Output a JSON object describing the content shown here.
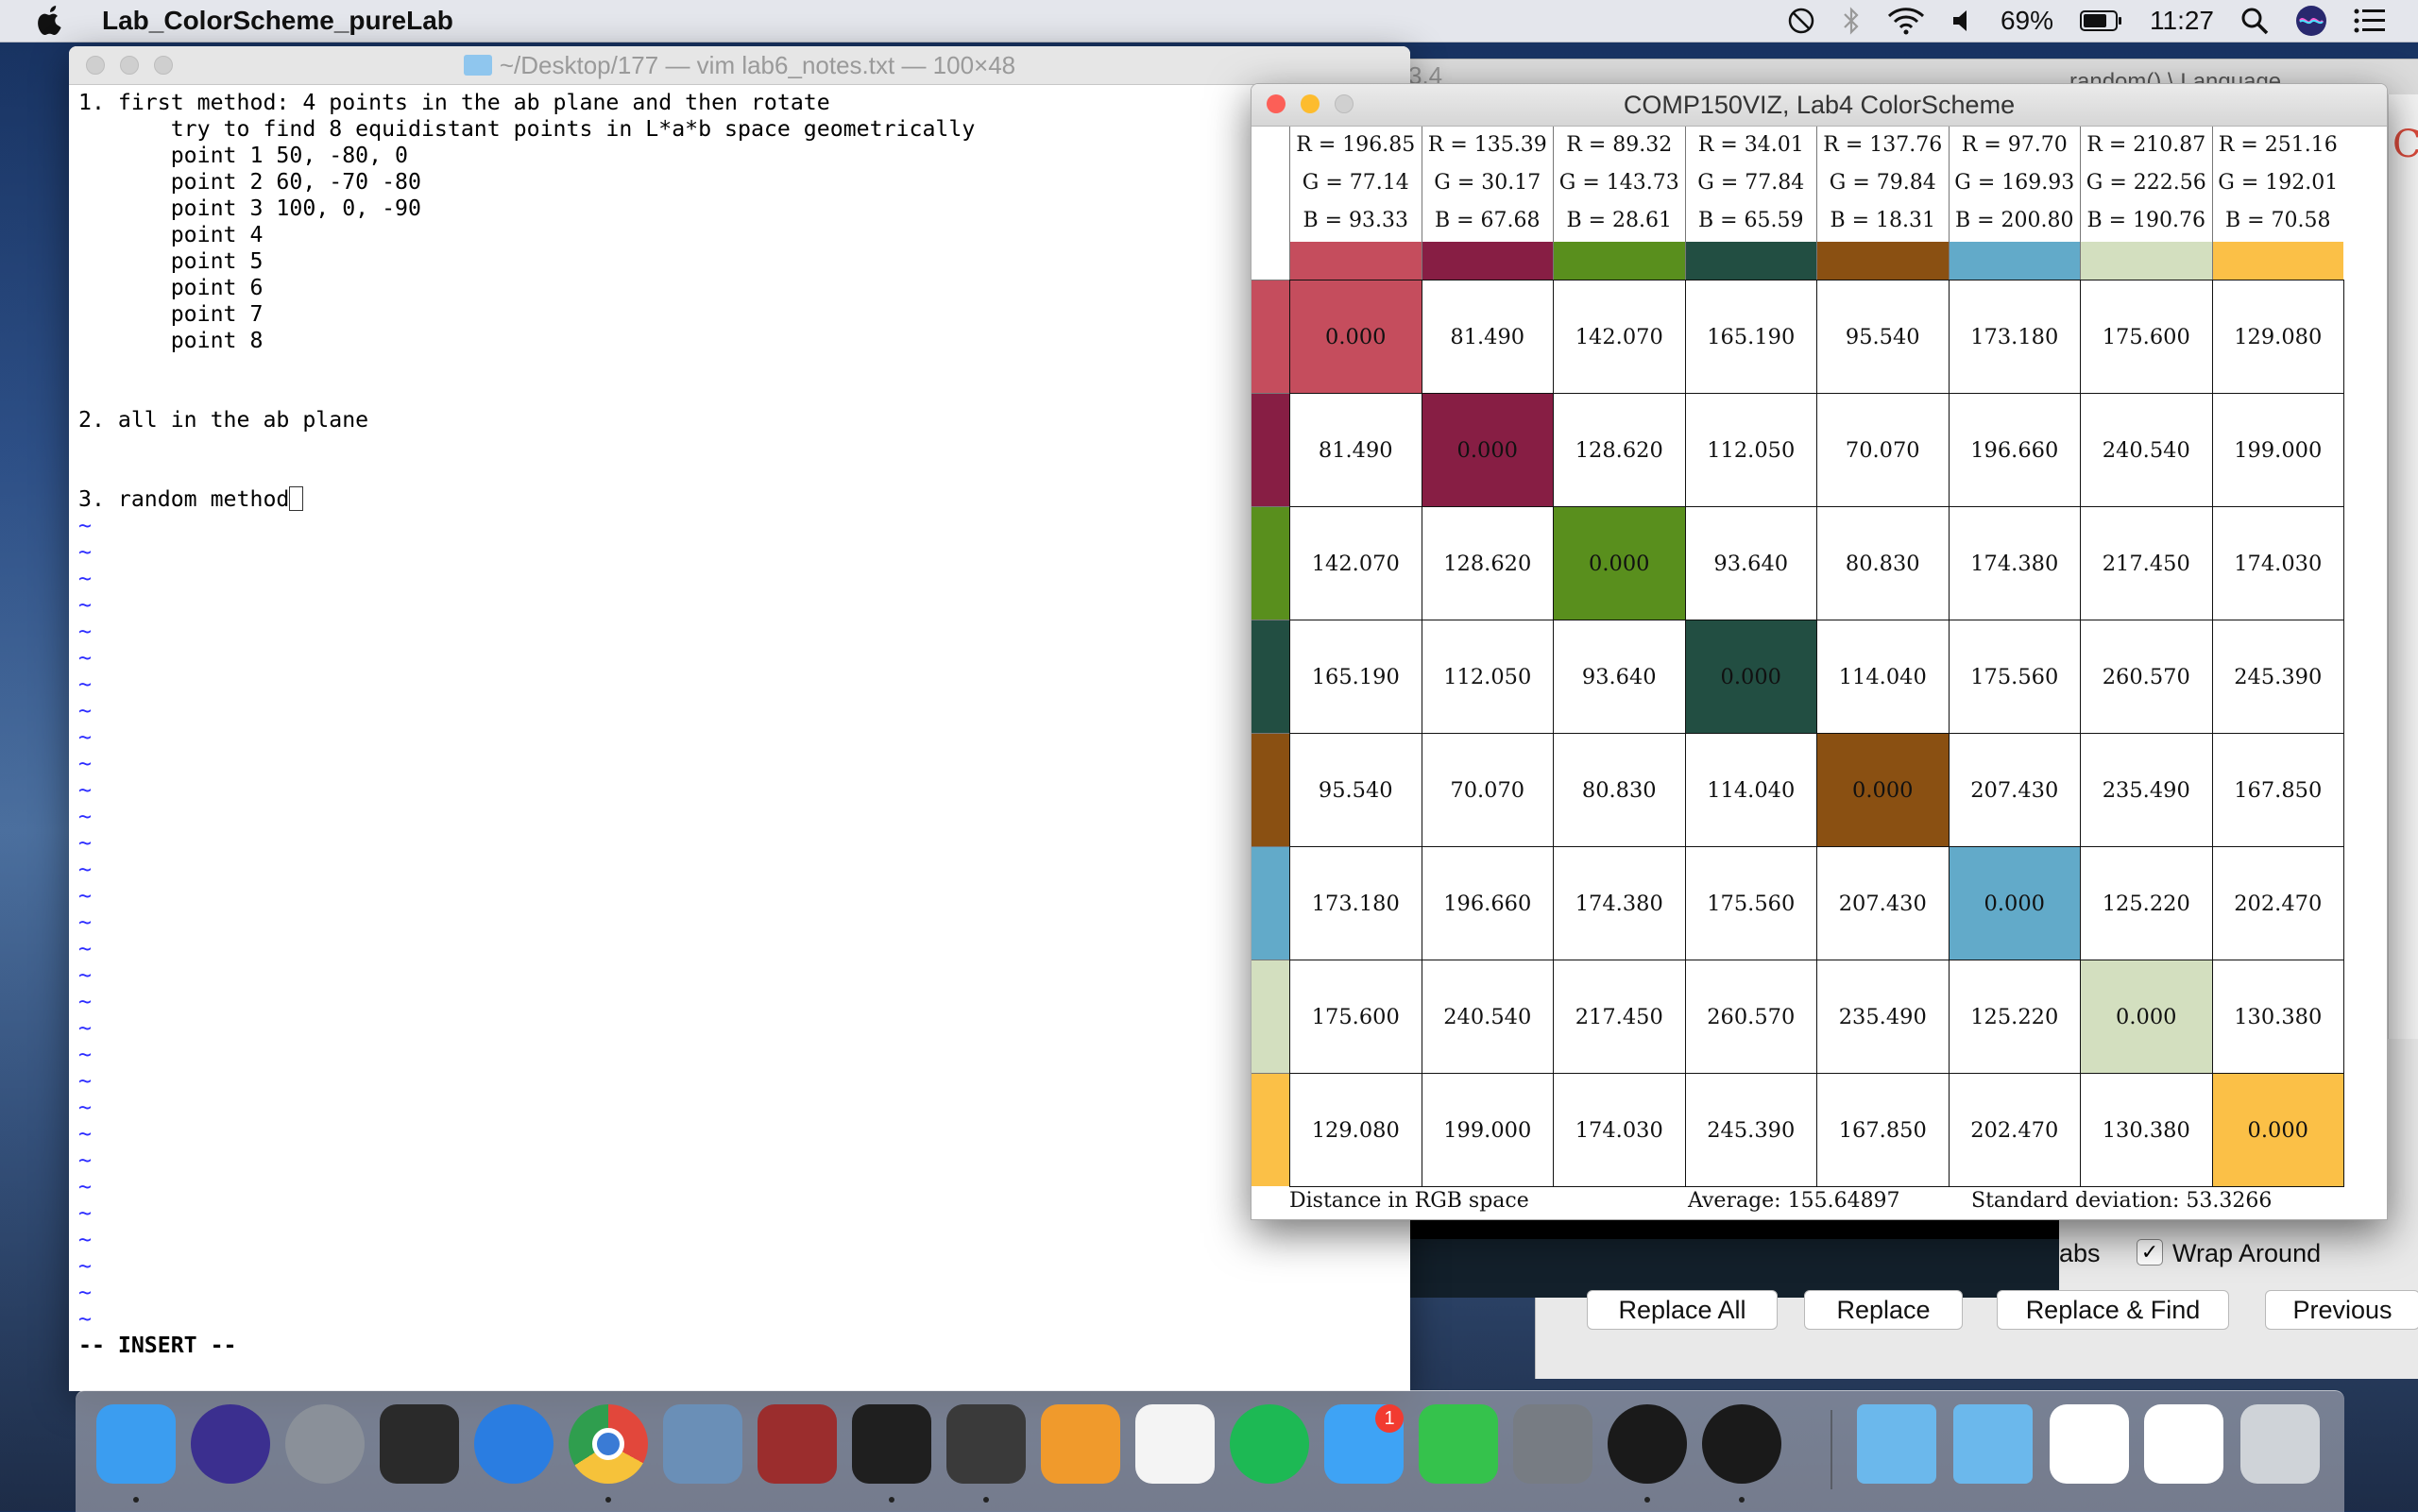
{
  "menubar": {
    "app_name": "Lab_ColorScheme_pureLab",
    "battery": "69%",
    "time": "11:27",
    "icons": [
      "apple-icon",
      "dnd-icon",
      "bluetooth-icon",
      "wifi-icon",
      "volume-icon",
      "battery-icon",
      "spotlight-icon",
      "siri-icon",
      "notification-center-icon"
    ]
  },
  "background": {
    "tab_fragment": "3.4",
    "tab_fragment2": "random() \\ Language",
    "find_bar": {
      "tabs_label": "abs",
      "wrap_label": "Wrap Around",
      "wrap_checked": "✓",
      "replace_all": "Replace All",
      "replace": "Replace",
      "replace_find": "Replace & Find",
      "previous": "Previous"
    },
    "edge_letter": "C"
  },
  "vim": {
    "title": "~/Desktop/177 — vim lab6_notes.txt — 100×48",
    "lines": [
      "1. first method: 4 points in the ab plane and then rotate",
      "       try to find 8 equidistant points in L*a*b space geometrically",
      "       point 1 50, -80, 0",
      "       point 2 60, -70 -80",
      "       point 3 100, 0, -90",
      "       point 4",
      "       point 5",
      "       point 6",
      "       point 7",
      "       point 8",
      "",
      "",
      "2. all in the ab plane",
      "",
      "",
      "3. random method"
    ],
    "tilde_count": 31,
    "mode": "-- INSERT --"
  },
  "colorwin": {
    "title": "COMP150VIZ, Lab4 ColorScheme",
    "colors": [
      {
        "r": "R = 196.85",
        "g": "G = 77.14",
        "b": "B = 93.33",
        "hex": "#c54d5d"
      },
      {
        "r": "R = 135.39",
        "g": "G = 30.17",
        "b": "B = 67.68",
        "hex": "#871e44"
      },
      {
        "r": "R = 89.32",
        "g": "G = 143.73",
        "b": "B = 28.61",
        "hex": "#598f1d"
      },
      {
        "r": "R = 34.01",
        "g": "G = 77.84",
        "b": "B = 65.59",
        "hex": "#224e42"
      },
      {
        "r": "R = 137.76",
        "g": "G = 79.84",
        "b": "B = 18.31",
        "hex": "#8a5012"
      },
      {
        "r": "R = 97.70",
        "g": "G = 169.93",
        "b": "B = 200.80",
        "hex": "#62aac9"
      },
      {
        "r": "R = 210.87",
        "g": "G = 222.56",
        "b": "B = 190.76",
        "hex": "#d3dfbf"
      },
      {
        "r": "R = 251.16",
        "g": "G = 192.01",
        "b": "B = 70.58",
        "hex": "#fbc047"
      }
    ],
    "matrix": [
      [
        "0.000",
        "81.490",
        "142.070",
        "165.190",
        "95.540",
        "173.180",
        "175.600",
        "129.080"
      ],
      [
        "81.490",
        "0.000",
        "128.620",
        "112.050",
        "70.070",
        "196.660",
        "240.540",
        "199.000"
      ],
      [
        "142.070",
        "128.620",
        "0.000",
        "93.640",
        "80.830",
        "174.380",
        "217.450",
        "174.030"
      ],
      [
        "165.190",
        "112.050",
        "93.640",
        "0.000",
        "114.040",
        "175.560",
        "260.570",
        "245.390"
      ],
      [
        "95.540",
        "70.070",
        "80.830",
        "114.040",
        "0.000",
        "207.430",
        "235.490",
        "167.850"
      ],
      [
        "173.180",
        "196.660",
        "174.380",
        "175.560",
        "207.430",
        "0.000",
        "125.220",
        "202.470"
      ],
      [
        "175.600",
        "240.540",
        "217.450",
        "260.570",
        "235.490",
        "125.220",
        "0.000",
        "130.380"
      ],
      [
        "129.080",
        "199.000",
        "174.030",
        "245.390",
        "167.850",
        "202.470",
        "130.380",
        "0.000"
      ]
    ],
    "status": {
      "mode": "Distance in RGB space",
      "average": "Average: 155.64897",
      "stddev": "Standard deviation: 53.3266"
    }
  },
  "dock": {
    "items": [
      {
        "name": "finder-icon",
        "running": true,
        "color": "#3b9df0"
      },
      {
        "name": "siri-icon",
        "running": false,
        "color": "#3b2f8f"
      },
      {
        "name": "launchpad-icon",
        "running": false,
        "color": "#8a9099"
      },
      {
        "name": "activity-monitor-icon",
        "running": false,
        "color": "#2a2a2a"
      },
      {
        "name": "safari-icon",
        "running": false,
        "color": "#2a7de1"
      },
      {
        "name": "chrome-icon",
        "running": true,
        "color": "#e2473b"
      },
      {
        "name": "preview-icon",
        "running": false,
        "color": "#6a8fb7"
      },
      {
        "name": "dictionary-icon",
        "running": false,
        "color": "#9b2d2d"
      },
      {
        "name": "terminal-icon",
        "running": true,
        "color": "#1f1f1f"
      },
      {
        "name": "sublime-text-icon",
        "running": true,
        "color": "#3a3a3a"
      },
      {
        "name": "pages-icon",
        "running": false,
        "color": "#f09a2c"
      },
      {
        "name": "photos-icon",
        "running": false,
        "color": "#f4f4f4"
      },
      {
        "name": "spotify-icon",
        "running": false,
        "color": "#1db954"
      },
      {
        "name": "messages-icon",
        "running": false,
        "color": "#3ea3f5",
        "badge": "1"
      },
      {
        "name": "facetime-icon",
        "running": false,
        "color": "#35c24c"
      },
      {
        "name": "system-preferences-icon",
        "running": false,
        "color": "#777c83"
      },
      {
        "name": "processing-icon",
        "running": true,
        "color": "#1a1a1a"
      },
      {
        "name": "quicktime-icon",
        "running": true,
        "color": "#1a1a1a"
      },
      {
        "name": "documents-folder-icon",
        "running": false,
        "color": "#6bb8ec"
      },
      {
        "name": "downloads-folder-icon",
        "running": false,
        "color": "#6bb8ec"
      },
      {
        "name": "chrome-window-thumbnail-icon",
        "running": false,
        "color": "#ffffff"
      },
      {
        "name": "chrome-window-thumbnail-icon-2",
        "running": false,
        "color": "#ffffff"
      },
      {
        "name": "trash-icon",
        "running": false,
        "color": "#cfd3d8"
      }
    ]
  }
}
